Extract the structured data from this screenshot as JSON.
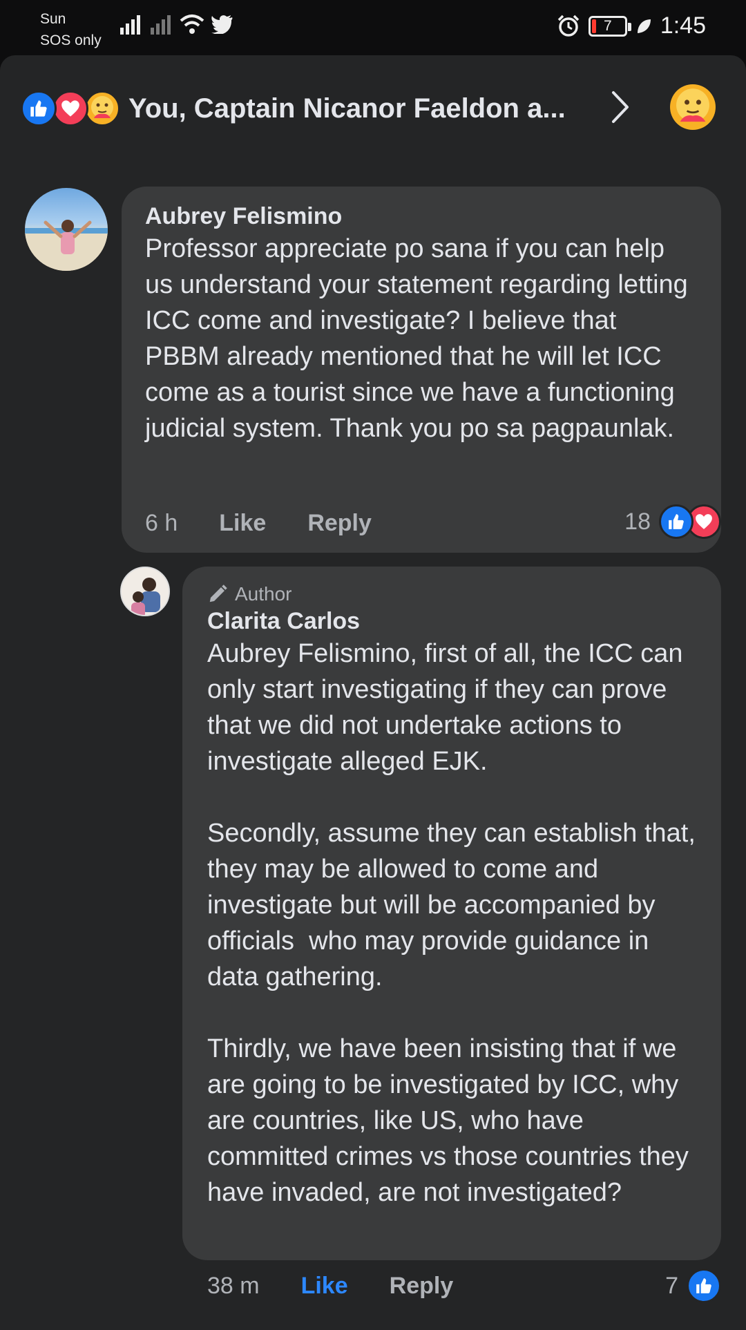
{
  "status_bar": {
    "carrier": "Sun",
    "sos": "SOS only",
    "battery": "7",
    "time": "1:45"
  },
  "reactions_header": {
    "reactors_text": "You, Captain Nicanor Faeldon a...",
    "icons": [
      "like-icon",
      "love-icon",
      "care-icon"
    ]
  },
  "comments": [
    {
      "author": "Aubrey Felismino",
      "text": "Professor appreciate po sana if you can help us understand your statement regarding letting ICC come and investigate? I believe that PBBM already mentioned that he will let ICC come as a tourist since we have a functioning judicial system. Thank you po sa pagpaunlak.",
      "time": "6 h",
      "like_label": "Like",
      "reply_label": "Reply",
      "reaction_count": "18"
    },
    {
      "badge": "Author",
      "author": "Clarita Carlos",
      "text": "Aubrey Felismino, first of all, the ICC can only start investigating if they can prove that we did not undertake actions to investigate alleged EJK.\n\nSecondly, assume they can establish that, they may be allowed to come and investigate but will be accompanied by officials  who may provide guidance in data gathering.\n\nThirdly, we have been insisting that if we are going to be investigated by ICC, why are countries, like US, who have committed crimes vs those countries they have invaded, are not investigated?",
      "time": "38 m",
      "like_label": "Like",
      "reply_label": "Reply",
      "reaction_count": "7"
    }
  ],
  "colors": {
    "background": "#242526",
    "bubble": "#3a3b3c",
    "like_active": "#2d88ff",
    "like_icon_bg": "#1877f2",
    "love_icon_bg": "#f33e58"
  }
}
